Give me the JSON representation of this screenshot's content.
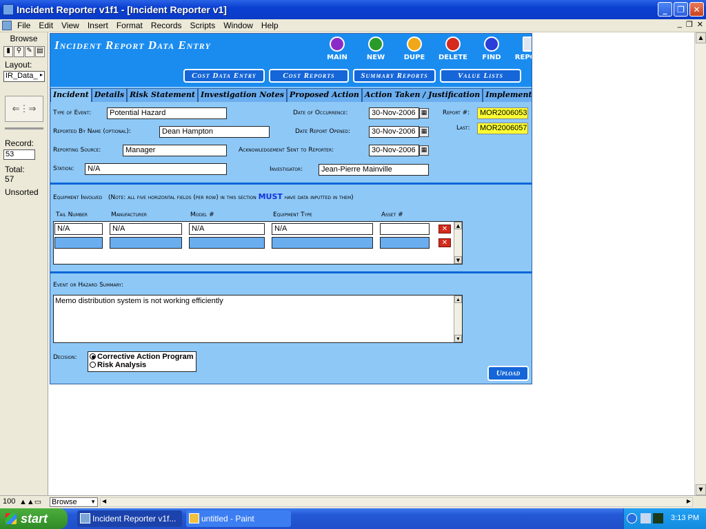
{
  "window": {
    "title": "Incident Reporter v1f1 - [Incident Reporter v1]"
  },
  "menu": [
    "File",
    "Edit",
    "View",
    "Insert",
    "Format",
    "Records",
    "Scripts",
    "Window",
    "Help"
  ],
  "status": {
    "mode": "Browse",
    "layout_label": "Layout:",
    "layout_value": "IR_Data_",
    "record_label": "Record:",
    "record_value": "53",
    "total_label": "Total:",
    "total_value": "57",
    "sort_state": "Unsorted",
    "zoom": "100",
    "mode_select": "Browse"
  },
  "form": {
    "title": "Incident Report Data Entry",
    "nav_buttons": [
      {
        "label": "MAIN",
        "color": "#8a2bc9"
      },
      {
        "label": "NEW",
        "color": "#2a9a2a"
      },
      {
        "label": "DUPE",
        "color": "#f0a818"
      },
      {
        "label": "DELETE",
        "color": "#d52a1c"
      },
      {
        "label": "FIND",
        "color": "#2a3fd8"
      },
      {
        "label": "REPORT",
        "color": "#1a8cf0"
      }
    ],
    "sub_buttons": [
      "Cost Data Entry",
      "Cost Reports",
      "Summary Reports",
      "Value Lists"
    ],
    "tabs": [
      "Incident",
      "Details",
      "Risk Statement",
      "Investigation Notes",
      "Proposed Action",
      "Action Taken / Justification",
      "Implementation / Targe"
    ],
    "fields": {
      "type_of_event_label": "Type of Event:",
      "type_of_event": "Potential Hazard",
      "reported_by_label": "Reported By Name (optional):",
      "reported_by": "Dean Hampton",
      "reporting_source_label": "Reporting Source:",
      "reporting_source": "Manager",
      "station_label": "Station:",
      "station": "N/A",
      "date_occurrence_label": "Date of Occurrence:",
      "date_occurrence": "30-Nov-2006",
      "date_opened_label": "Date Report Opened:",
      "date_opened": "30-Nov-2006",
      "ack_sent_label": "Acknowledgement Sent to Reporter:",
      "ack_sent": "30-Nov-2006",
      "investigator_label": "Investigator:",
      "investigator": "Jean-Pierre Mainville",
      "report_no_label": "Report #:",
      "report_no": "MOR2006053",
      "last_label": "Last:",
      "last": "MOR2006057"
    },
    "equipment": {
      "heading": "Equipment Involved",
      "note_prefix": "(Note: all five horizontal fields (per row) in this section",
      "note_must": "MUST",
      "note_suffix": "have data inputted in them)",
      "columns": [
        "Tail Number",
        "Manufacturer",
        "Model #",
        "Equipment Type",
        "Asset #"
      ],
      "rows": [
        [
          "N/A",
          "N/A",
          "N/A",
          "N/A",
          ""
        ],
        [
          "",
          "",
          "",
          "",
          ""
        ]
      ],
      "delete_glyph": "✕"
    },
    "summary": {
      "label": "Event or Hazard Summary:",
      "text": "Memo distribution system is not working efficiently"
    },
    "decision": {
      "label": "Decision:",
      "options": [
        {
          "label": "Corrective Action Program",
          "selected": true
        },
        {
          "label": "Risk Analysis",
          "selected": false
        }
      ]
    },
    "upload_label": "Upload"
  },
  "taskbar": {
    "start": "start",
    "items": [
      "Incident Reporter v1f...",
      "untitled - Paint"
    ],
    "clock": "3:13 PM"
  }
}
